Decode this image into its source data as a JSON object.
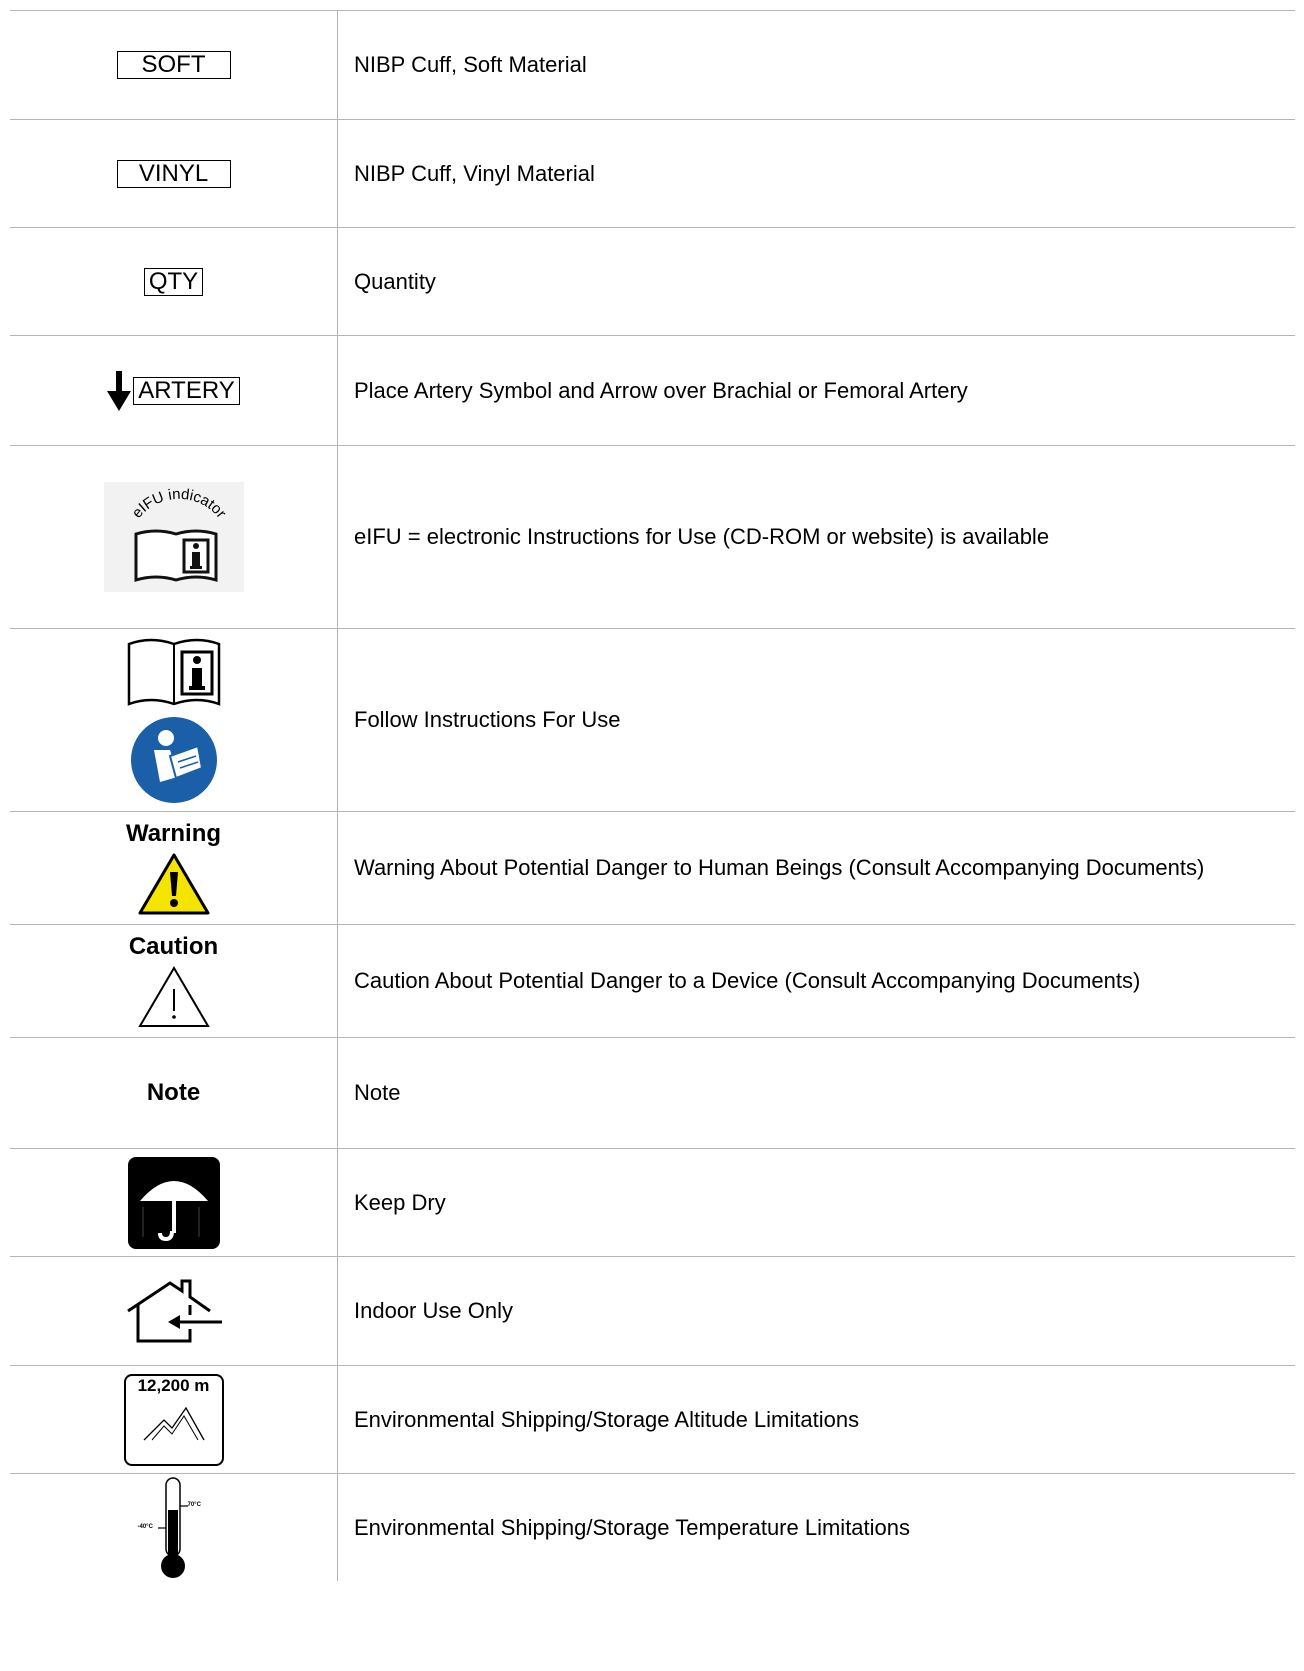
{
  "rows": [
    {
      "symbol_label": "SOFT",
      "description": "NIBP Cuff, Soft Material"
    },
    {
      "symbol_label": "VINYL",
      "description": "NIBP Cuff, Vinyl Material"
    },
    {
      "symbol_label": "QTY",
      "description": "Quantity"
    },
    {
      "symbol_label": "ARTERY",
      "icon": "down-arrow-icon",
      "description": "Place Artery Symbol and Arrow over Brachial or Femoral Artery"
    },
    {
      "icon": "eifu-indicator-icon",
      "icon_text": "eIFU indicator",
      "description": "eIFU = electronic Instructions for Use (CD-ROM or website) is available"
    },
    {
      "icon": "instructions-book-icon",
      "icon2": "read-manual-icon",
      "description": "Follow Instructions For Use"
    },
    {
      "symbol_label": "Warning",
      "icon": "warning-triangle-icon",
      "description": "Warning About Potential Danger to Human Beings (Consult Accompanying Documents)"
    },
    {
      "symbol_label": "Caution",
      "icon": "caution-triangle-icon",
      "description": "Caution About Potential Danger to a Device (Consult Accompanying Documents)"
    },
    {
      "symbol_label": "Note",
      "description": "Note"
    },
    {
      "icon": "umbrella-icon",
      "description": "Keep Dry"
    },
    {
      "icon": "indoor-house-icon",
      "description": "Indoor Use Only"
    },
    {
      "icon": "altitude-mountain-icon",
      "icon_text": "12,200 m",
      "description": "Environmental Shipping/Storage Altitude Limitations"
    },
    {
      "icon": "thermometer-icon",
      "icon_text_high": "70°C",
      "icon_text_low": "-40°C",
      "description": "Environmental Shipping/Storage Temperature Limitations"
    }
  ],
  "colors": {
    "warning_yellow": "#f5e400",
    "manual_blue": "#1a5fa8",
    "border": "#b4b4b4"
  }
}
